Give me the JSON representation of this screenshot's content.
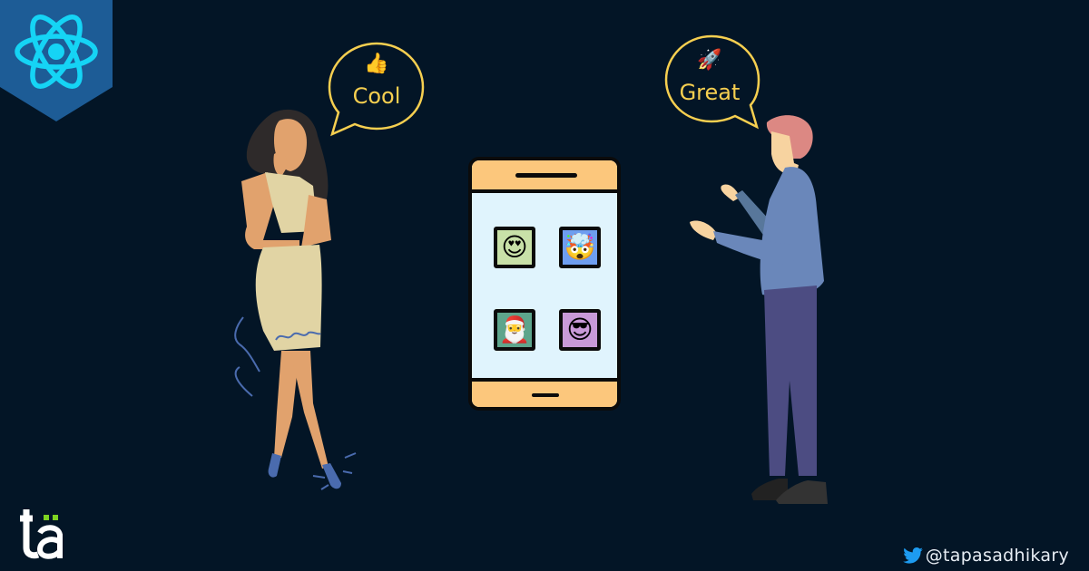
{
  "badge": {
    "icon": "react-logo",
    "color": "#1d5c96",
    "accent": "#15d4f5"
  },
  "bubbles": [
    {
      "text": "Cool",
      "emoji": "👍"
    },
    {
      "text": "Great",
      "emoji": "🚀"
    }
  ],
  "phone": {
    "apps": [
      {
        "emoji": "😍",
        "bg": "#c8e1a8",
        "name": "heart-eyes"
      },
      {
        "emoji": "🤯",
        "bg": "#6e9ef0",
        "name": "exploding-head"
      },
      {
        "emoji": "🎅",
        "bg": "#5ea58c",
        "name": "santa"
      },
      {
        "emoji": "😎",
        "bg": "#c99ad8",
        "name": "sunglasses"
      }
    ]
  },
  "logo": {
    "text": "tä",
    "dot_color": "#7ed321"
  },
  "footer": {
    "handle": "@tapasadhikary",
    "icon": "twitter-bird"
  },
  "colors": {
    "bg": "#031526",
    "bubble": "#f6cf50"
  }
}
